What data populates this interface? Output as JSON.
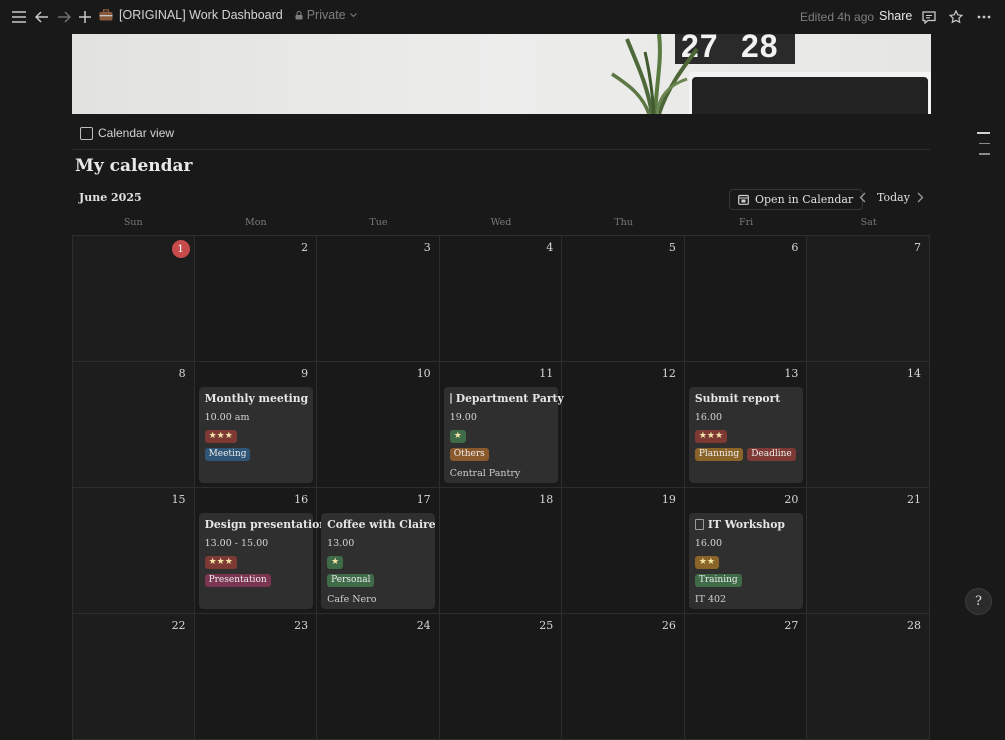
{
  "topbar": {
    "breadcrumb": "[ORIGINAL] Work Dashboard",
    "privacy": "Private",
    "edited": "Edited 4h ago",
    "share": "Share",
    "icons": [
      "menu-icon",
      "back-icon",
      "forward-icon",
      "plus-icon",
      "briefcase-icon",
      "lock-icon",
      "comment-icon",
      "star-icon",
      "more-icon"
    ]
  },
  "cover": {
    "clock_text_1": "27",
    "clock_text_2": "28"
  },
  "view": {
    "label": "Calendar view"
  },
  "calendar": {
    "title": "My calendar",
    "month": "June 2025",
    "open_button": "Open in Calendar",
    "today_button": "Today",
    "weekdays": [
      "Sun",
      "Mon",
      "Tue",
      "Wed",
      "Thu",
      "Fri",
      "Sat"
    ],
    "today_date": "1",
    "weeks": [
      [
        "1",
        "2",
        "3",
        "4",
        "5",
        "6",
        "7"
      ],
      [
        "8",
        "9",
        "10",
        "11",
        "12",
        "13",
        "14"
      ],
      [
        "15",
        "16",
        "17",
        "18",
        "19",
        "20",
        "21"
      ],
      [
        "22",
        "23",
        "24",
        "25",
        "26",
        "27",
        "28"
      ]
    ],
    "events": [
      {
        "title": "Monthly meeting",
        "time": "10.00 am",
        "stars": "★★★",
        "tags": [
          "Meeting"
        ],
        "location": ""
      },
      {
        "title": "Department Party",
        "time": "19.00",
        "stars": "★",
        "tags": [
          "Others"
        ],
        "location": "Central Pantry"
      },
      {
        "title": "Submit report",
        "time": "16.00",
        "stars": "★★★",
        "tags": [
          "Planning",
          "Deadline"
        ],
        "location": ""
      },
      {
        "title": "Design presentation",
        "time": "13.00 - 15.00",
        "stars": "★★★",
        "tags": [
          "Presentation"
        ],
        "location": ""
      },
      {
        "title": "Coffee with Claire",
        "time": "13.00",
        "stars": "★",
        "tags": [
          "Personal"
        ],
        "location": "Cafe Nero"
      },
      {
        "title": "IT Workshop",
        "time": "16.00",
        "stars": "★★",
        "tags": [
          "Training"
        ],
        "location": "IT 402"
      }
    ]
  },
  "colors": {
    "background": "#191919",
    "today_circle": "#c74b4b",
    "tag_meeting": "#2f5577",
    "tag_others": "#8a5a2c",
    "tag_planning": "#8a6428",
    "tag_deadline": "#7d3a34",
    "tag_presentation": "#7a3550",
    "tag_personal": "#3f6b48",
    "tag_training": "#3f6b48",
    "stars_high": "#7d3a34",
    "stars_mid": "#8a6428",
    "stars_low": "#3f6b48"
  },
  "help": {
    "label": "?"
  }
}
